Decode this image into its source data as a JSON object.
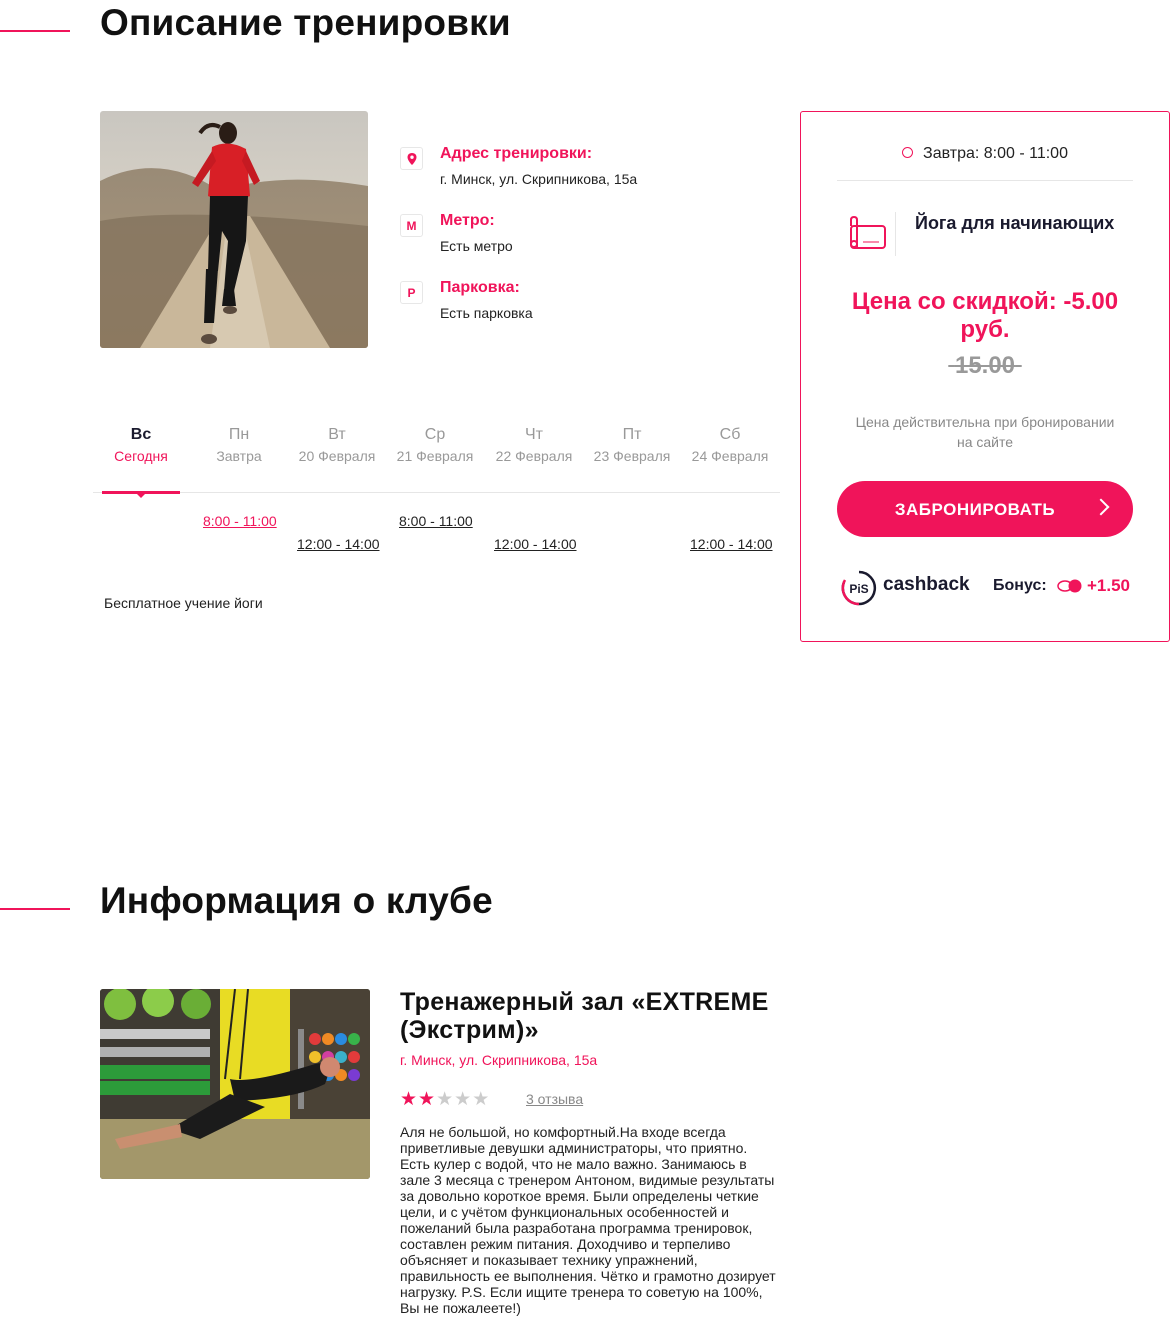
{
  "workout_section": {
    "title": "Описание тренировки"
  },
  "info": {
    "address": {
      "title": "Адрес тренировки:",
      "text": "г. Минск, ул. Скрипникова, 15а",
      "icon": "location-pin-icon"
    },
    "metro": {
      "title": "Метро:",
      "text": "Есть метро",
      "icon": "metro-icon",
      "glyph": "М"
    },
    "parking": {
      "title": "Парковка:",
      "text": "Есть парковка",
      "icon": "parking-icon",
      "glyph": "P"
    }
  },
  "schedule": {
    "days": [
      {
        "name": "Вс",
        "date": "Сегодня",
        "active": true
      },
      {
        "name": "Пн",
        "date": "Завтра"
      },
      {
        "name": "Вт",
        "date": "20 Февраля"
      },
      {
        "name": "Ср",
        "date": "21 Февраля"
      },
      {
        "name": "Чт",
        "date": "22 Февраля"
      },
      {
        "name": "Пт",
        "date": "23 Февраля"
      },
      {
        "name": "Сб",
        "date": "24 Февраля"
      }
    ],
    "slots": {
      "mon": "8:00 - 11:00",
      "tue": "12:00 - 14:00",
      "wed": "8:00 - 11:00",
      "thu": "12:00 - 14:00",
      "sat": "12:00 - 14:00"
    },
    "description": "Бесплатное учение йоги"
  },
  "booking": {
    "time": "Завтра: 8:00 - 11:00",
    "title": "Йога для начинающих",
    "discount_price": "Цена со скидкой: -5.00 руб.",
    "old_price": "15.00",
    "note": "Цена действительна при бронировании на сайте",
    "button": "ЗАБРОНИРОВАТЬ",
    "cashback_logo": "PiS",
    "cashback": "cashback",
    "bonus_label": "Бонус:",
    "bonus_value": "+1.50",
    "colors": {
      "accent": "#f0145a",
      "dark": "#1a1a2e"
    }
  },
  "club_section": {
    "title": "Информация о клубе"
  },
  "club": {
    "name": "Тренажерный зал «EXTREME (Экстрим)»",
    "address": "г. Минск, ул. Скрипникова, 15а",
    "rating": 2,
    "rating_max": 5,
    "reviews": "3 отзыва",
    "review_text": "Аля не большой, но комфортный.На входе всегда приветливые девушки администраторы, что приятно. Есть кулер с водой, что не мало важно. Занимаюсь в зале 3 месяца с тренером Антоном, видимые результаты за довольно короткое время. Были определены четкие цели, и с учётом функциональных особенностей и пожеланий была разработана программа тренировок, составлен режим питания. Доходчиво и терпеливо объясняет и показывает технику упражнений, правильность ее выполнения. Чётко и грамотно дозирует нагрузку. P.S. Если ищите тренера то советую на 100%, Вы не пожалеете!)"
  }
}
